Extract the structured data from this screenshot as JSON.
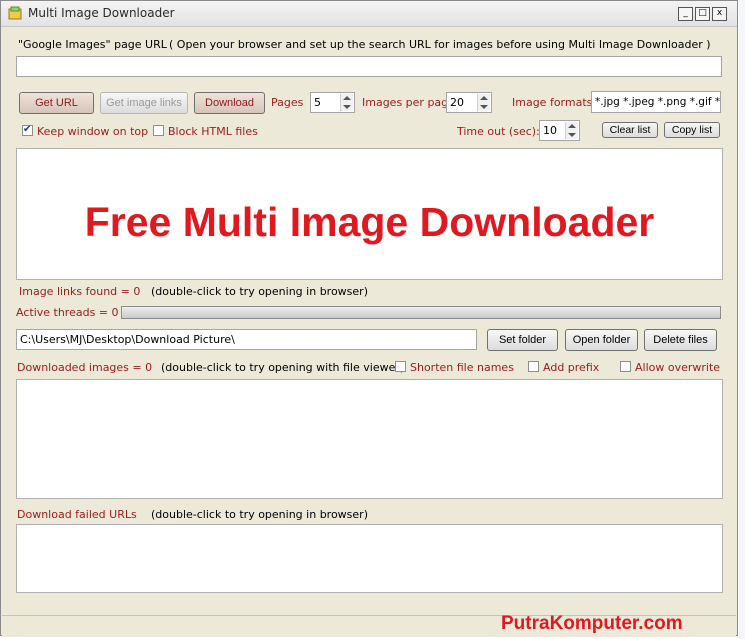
{
  "window": {
    "title": "Multi Image Downloader",
    "controls": [
      "_",
      "□",
      "x"
    ]
  },
  "url_section": {
    "label": "\"Google Images\" page URL",
    "hint": "( Open your browser and  set up the search URL for images before using Multi Image Downloader )",
    "url_value": ""
  },
  "toolbar": {
    "get_url_label": "Get URL",
    "get_image_links_label": "Get image links",
    "download_label": "Download",
    "pages_label": "Pages",
    "pages_value": "5",
    "images_per_page_label": "Images per page",
    "images_per_page_value": "20",
    "image_formats_label": "Image formats",
    "image_formats_value": "*.jpg *.jpeg *.png *.gif *.bmp",
    "keep_on_top_label": "Keep window on top",
    "keep_on_top_checked": true,
    "block_html_label": "Block HTML files",
    "block_html_checked": false,
    "timeout_label": "Time out (sec):",
    "timeout_value": "10",
    "clear_list_label": "Clear list",
    "copy_list_label": "Copy list"
  },
  "links_panel": {
    "banner_text": "Free Multi Image Downloader",
    "found_label": "Image links found = 0",
    "found_hint": "(double-click to try opening in browser)"
  },
  "threads": {
    "label": "Active threads = 0",
    "progress": 0
  },
  "folder": {
    "path": "C:\\Users\\MJ\\Desktop\\Download Picture\\",
    "set_folder_label": "Set folder",
    "open_folder_label": "Open folder",
    "delete_files_label": "Delete files"
  },
  "downloaded": {
    "label": "Downloaded images = 0",
    "hint": "(double-click to try opening with file viewer)",
    "shorten_label": "Shorten file names",
    "shorten_checked": false,
    "prefix_label": "Add prefix",
    "prefix_checked": false,
    "overwrite_label": "Allow overwrite",
    "overwrite_checked": false
  },
  "failed": {
    "label": "Download failed URLs",
    "hint": "(double-click to try opening in browser)"
  },
  "watermark": "PutraKomputer.com",
  "colors": {
    "window_bg": "#ece9d8",
    "label_red": "#9b1c1c",
    "banner_red": "#e01820"
  }
}
